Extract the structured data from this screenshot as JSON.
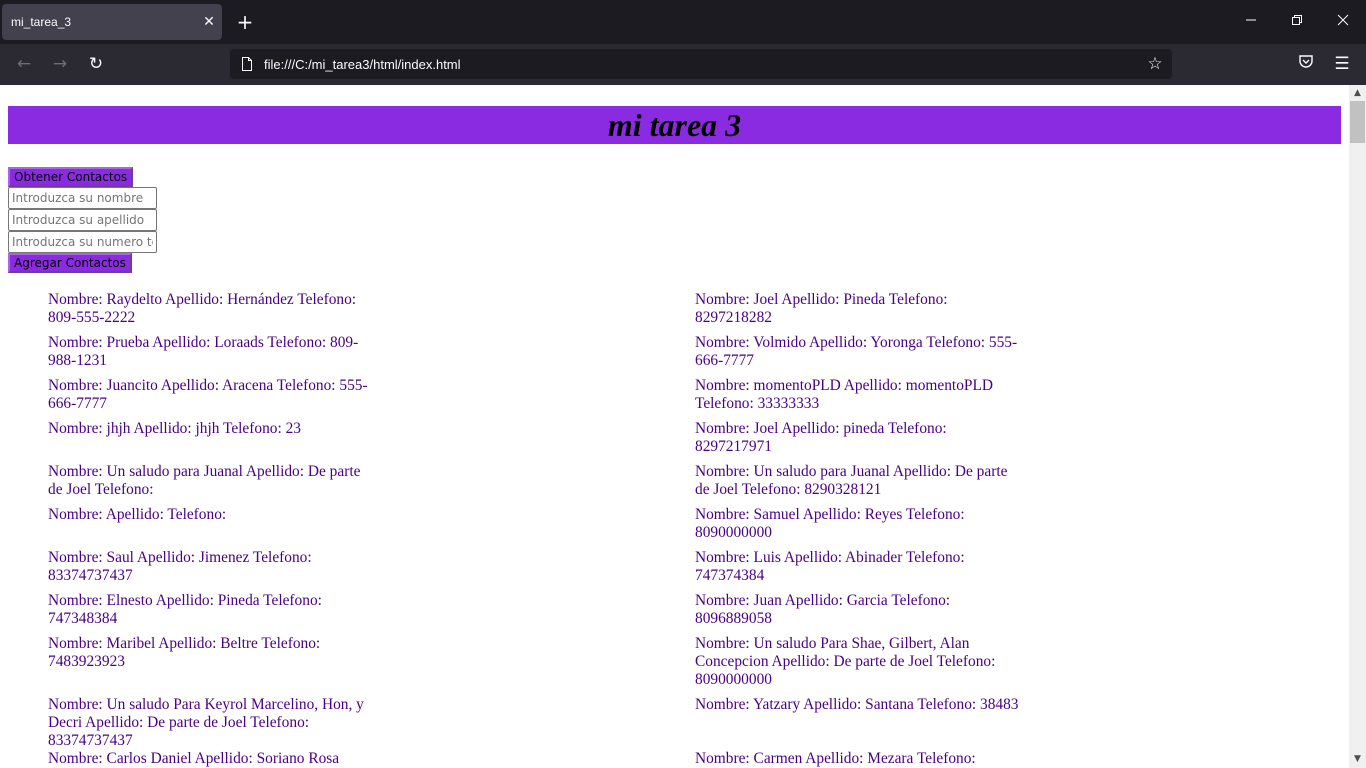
{
  "browser": {
    "tab_title": "mi_tarea_3",
    "url": "file:///C:/mi_tarea3/html/index.html"
  },
  "page": {
    "heading": "mi tarea 3",
    "get_button": "Obtener Contactos",
    "name_placeholder": "Introduzca su nombre",
    "lastname_placeholder": "Introduzca su apellido",
    "phone_placeholder": "Introduzca su numero te",
    "add_button": "Agregar Contactos"
  },
  "contacts": [
    {
      "text": "Nombre: Raydelto Apellido: Hernández Telefono: 809-555-2222"
    },
    {
      "text": "Nombre: Joel Apellido: Pineda Telefono: 8297218282"
    },
    {
      "text": "Nombre: Prueba Apellido: Loraads Telefono: 809-988-1231"
    },
    {
      "text": "Nombre: Volmido Apellido: Yoronga Telefono: 555-666-7777"
    },
    {
      "text": "Nombre: Juancito Apellido: Aracena Telefono: 555-666-7777"
    },
    {
      "text": "Nombre: momentoPLD Apellido: momentoPLD Telefono: 33333333"
    },
    {
      "text": "Nombre: jhjh Apellido: jhjh Telefono: 23"
    },
    {
      "text": "Nombre: Joel Apellido: pineda Telefono: 8297217971"
    },
    {
      "text": "Nombre: Un saludo para Juanal Apellido: De parte de Joel Telefono:"
    },
    {
      "text": "Nombre: Un saludo para Juanal Apellido: De parte de Joel Telefono: 8290328121"
    },
    {
      "text": "Nombre: Apellido: Telefono:"
    },
    {
      "text": "Nombre: Samuel Apellido: Reyes Telefono: 8090000000"
    },
    {
      "text": "Nombre: Saul Apellido: Jimenez Telefono: 83374737437"
    },
    {
      "text": "Nombre: Luis Apellido: Abinader Telefono: 747374384"
    },
    {
      "text": "Nombre: Elnesto Apellido: Pineda Telefono: 747348384"
    },
    {
      "text": "Nombre: Juan Apellido: Garcia Telefono: 8096889058"
    },
    {
      "text": "Nombre: Maribel Apellido: Beltre Telefono: 7483923923"
    },
    {
      "text": "Nombre: Un saludo Para Shae, Gilbert, Alan Concepcion Apellido: De parte de Joel Telefono: 8090000000"
    },
    {
      "text": "Nombre: Un saludo Para Keyrol Marcelino, Hon, y Decri Apellido: De parte de Joel Telefono: 83374737437"
    },
    {
      "text": "Nombre: Yatzary Apellido: Santana Telefono: 38483"
    },
    {
      "text": "Nombre: Carlos Daniel Apellido: Soriano Rosa"
    },
    {
      "text": "Nombre: Carmen Apellido: Mezara Telefono:"
    }
  ]
}
